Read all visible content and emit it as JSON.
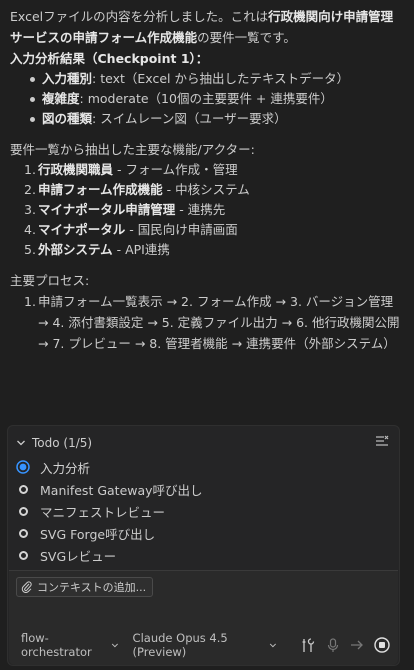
{
  "intro": {
    "part1": "Excelファイルの内容を分析しました。これは",
    "bold1": "行政機関向け申請管理サービスの申請フォーム作成機能",
    "part2": "の要件一覧です。"
  },
  "analysis": {
    "heading": "入力分析結果（Checkpoint 1）：",
    "items": [
      {
        "label": "入力種別",
        "value": ": text（Excel から抽出したテキストデータ）"
      },
      {
        "label": "複雑度",
        "value": ": moderate（10個の主要要件 + 連携要件）"
      },
      {
        "label": "図の種類",
        "value": ": スイムレーン図（ユーザー要求）"
      }
    ]
  },
  "actors": {
    "heading": "要件一覧から抽出した主要な機能/アクター:",
    "items": [
      {
        "num": "1.",
        "label": "行政機関職員",
        "desc": " - フォーム作成・管理"
      },
      {
        "num": "2.",
        "label": "申請フォーム作成機能",
        "desc": " - 中核システム"
      },
      {
        "num": "3.",
        "label": "マイナポータル申請管理",
        "desc": " - 連携先"
      },
      {
        "num": "4.",
        "label": "マイナポータル",
        "desc": " - 国民向け申請画面"
      },
      {
        "num": "5.",
        "label": "外部システム",
        "desc": " - API連携"
      }
    ]
  },
  "process": {
    "heading": "主要プロセス:",
    "num": "1.",
    "text": "申請フォーム一覧表示 → 2. フォーム作成 → 3. バージョン管理 → 4. 添付書類設定 → 5. 定義ファイル出力 → 6. 他行政機関公開 → 7. プレビュー → 8. 管理者機能 → 連携要件（外部システム）"
  },
  "todo": {
    "title": "Todo (1/5)",
    "items": [
      {
        "label": "入力分析",
        "status": "in-progress"
      },
      {
        "label": "Manifest Gateway呼び出し",
        "status": "pending"
      },
      {
        "label": "マニフェストレビュー",
        "status": "pending"
      },
      {
        "label": "SVG Forge呼び出し",
        "status": "pending"
      },
      {
        "label": "SVGレビュー",
        "status": "pending"
      }
    ]
  },
  "input": {
    "context_button": "コンテキストの追加...",
    "agent": "flow-orchestrator",
    "model": "Claude Opus 4.5 (Preview)"
  },
  "colors": {
    "accent": "#3794ff",
    "background": "#1f1f1f",
    "panel": "#252526"
  }
}
